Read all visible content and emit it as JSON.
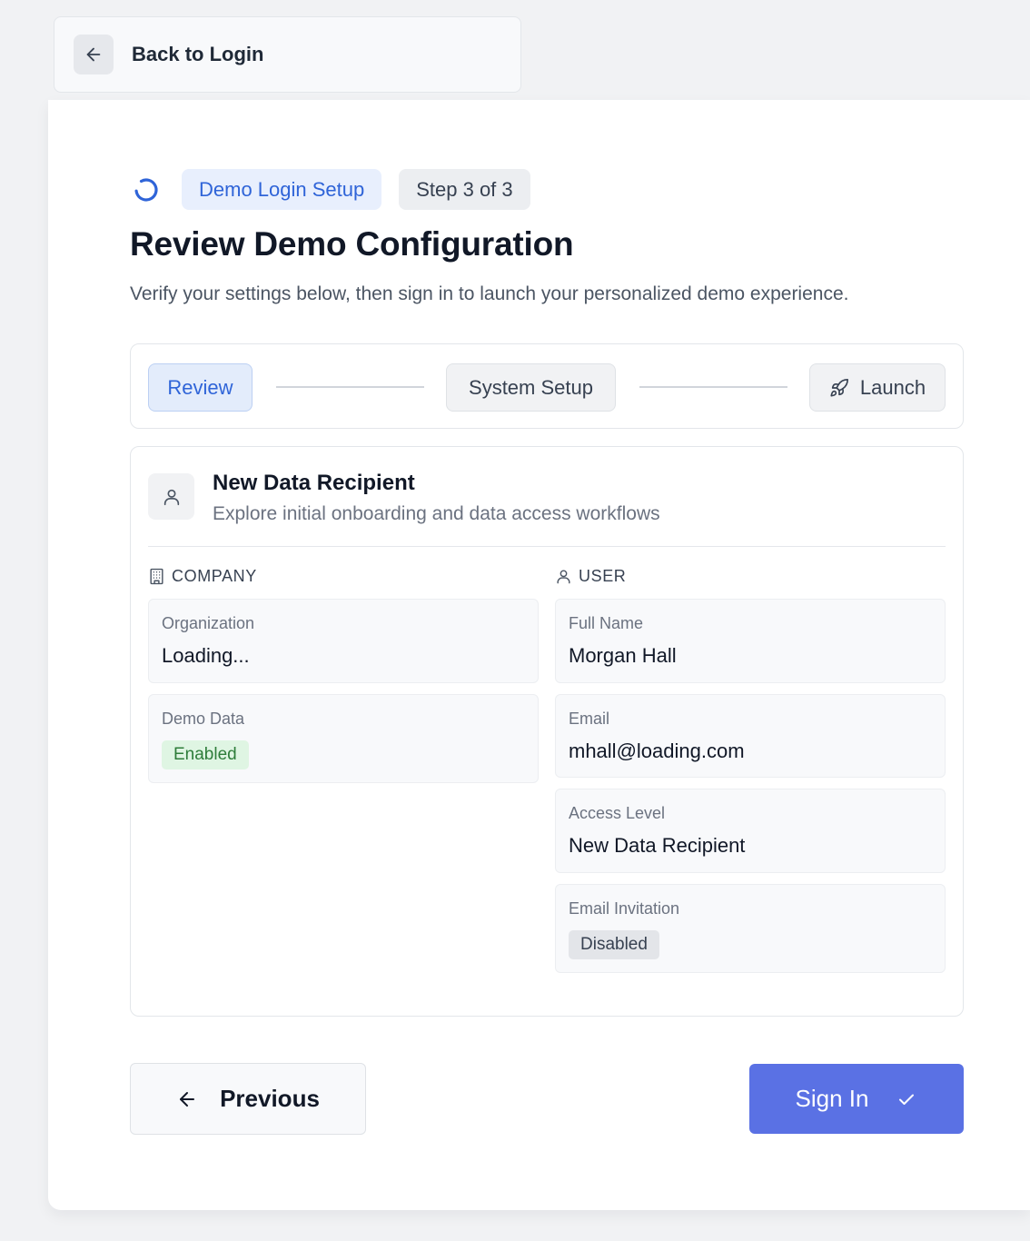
{
  "nav": {
    "back_label": "Back to Login"
  },
  "header": {
    "badge_primary": "Demo Login Setup",
    "badge_step": "Step 3 of 3",
    "title": "Review Demo Configuration",
    "subtitle": "Verify your settings below, then sign in to launch your personalized demo experience."
  },
  "stepper": {
    "steps": [
      {
        "label": "Review",
        "state": "active"
      },
      {
        "label": "System Setup",
        "state": "pending"
      },
      {
        "label": "Launch",
        "state": "pending",
        "icon": "rocket-icon"
      }
    ]
  },
  "role": {
    "icon": "user-icon",
    "title": "New Data Recipient",
    "description": "Explore initial onboarding and data access workflows"
  },
  "company": {
    "heading": "COMPANY",
    "icon": "building-icon",
    "fields": [
      {
        "label": "Organization",
        "value": "Loading..."
      },
      {
        "label": "Demo Data",
        "value": "Enabled",
        "status": "enabled"
      }
    ]
  },
  "user": {
    "heading": "USER",
    "icon": "user-icon",
    "fields": [
      {
        "label": "Full Name",
        "value": "Morgan Hall"
      },
      {
        "label": "Email",
        "value": "mhall@loading.com"
      },
      {
        "label": "Access Level",
        "value": "New Data Recipient"
      },
      {
        "label": "Email Invitation",
        "value": "Disabled",
        "status": "disabled"
      }
    ]
  },
  "actions": {
    "previous_label": "Previous",
    "sign_in_label": "Sign In"
  },
  "colors": {
    "accent": "#5a71e4",
    "accent_text": "#2f64d8",
    "enabled_bg": "#dff5e3",
    "enabled_text": "#2e7d3a",
    "disabled_bg": "#e3e5e9"
  }
}
